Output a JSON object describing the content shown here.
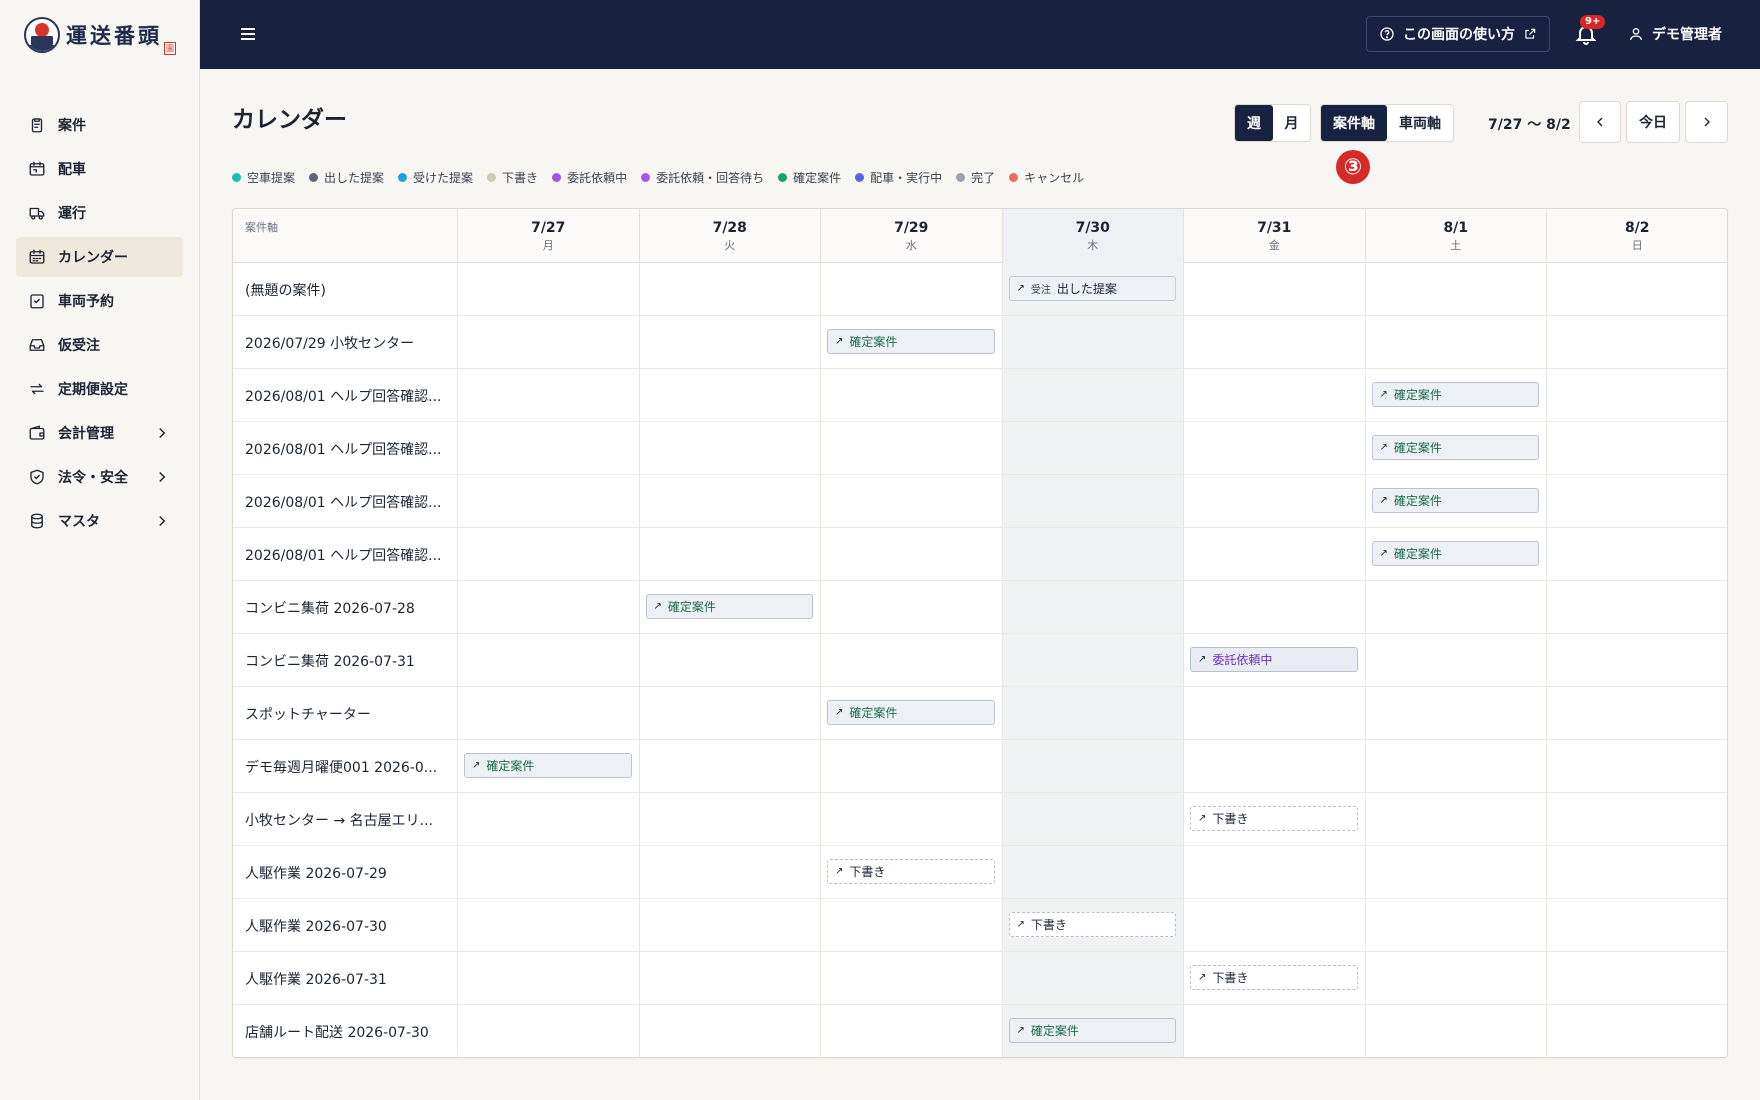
{
  "brand": {
    "name": "運送番頭",
    "seal": "圖"
  },
  "sidebar": {
    "items": [
      {
        "label": "案件",
        "icon": "clipboard-icon"
      },
      {
        "label": "配車",
        "icon": "calendar-truck-icon"
      },
      {
        "label": "運行",
        "icon": "truck-icon"
      },
      {
        "label": "カレンダー",
        "icon": "calendar-icon",
        "active": true
      },
      {
        "label": "車両予約",
        "icon": "calendar-check-icon"
      },
      {
        "label": "仮受注",
        "icon": "inbox-icon"
      },
      {
        "label": "定期便設定",
        "icon": "repeat-icon"
      },
      {
        "label": "会計管理",
        "icon": "wallet-icon",
        "chevron": true
      },
      {
        "label": "法令・安全",
        "icon": "shield-icon",
        "chevron": true
      },
      {
        "label": "マスタ",
        "icon": "database-icon",
        "chevron": true
      }
    ]
  },
  "header": {
    "help_label": "この画面の使い方",
    "badge": "9+",
    "user_label": "デモ管理者"
  },
  "page": {
    "title": "カレンダー",
    "view_week": "週",
    "view_month": "月",
    "axis_case": "案件軸",
    "axis_vehicle": "車両軸",
    "range": "7/27 〜 8/2",
    "today_label": "今日",
    "step_marker": "③"
  },
  "legend": [
    {
      "label": "空車提案",
      "color": "#1bbfb0"
    },
    {
      "label": "出した提案",
      "color": "#5d6678"
    },
    {
      "label": "受けた提案",
      "color": "#1e9fe0"
    },
    {
      "label": "下書き",
      "color": "#d2c8b6"
    },
    {
      "label": "委託依頼中",
      "color": "#9b59e3"
    },
    {
      "label": "委託依頼・回答待ち",
      "color": "#a855f0"
    },
    {
      "label": "確定案件",
      "color": "#14a56a"
    },
    {
      "label": "配車・実行中",
      "color": "#5b62e8"
    },
    {
      "label": "完了",
      "color": "#9aa3b2"
    },
    {
      "label": "キャンセル",
      "color": "#ef6b5f"
    }
  ],
  "grid": {
    "axis_label": "案件軸",
    "days": [
      {
        "date": "7/27",
        "weekday": "月"
      },
      {
        "date": "7/28",
        "weekday": "火"
      },
      {
        "date": "7/29",
        "weekday": "水"
      },
      {
        "date": "7/30",
        "weekday": "木",
        "today": true
      },
      {
        "date": "7/31",
        "weekday": "金"
      },
      {
        "date": "8/1",
        "weekday": "土"
      },
      {
        "date": "8/2",
        "weekday": "日"
      }
    ],
    "rows": [
      {
        "label": "(無題の案件)",
        "day": 3,
        "kind": "dashita",
        "text": "出した提案",
        "tag": "受注"
      },
      {
        "label": "2026/07/29 小牧センター",
        "day": 2,
        "kind": "kakutei",
        "text": "確定案件"
      },
      {
        "label": "2026/08/01 ヘルプ回答確認...",
        "day": 5,
        "kind": "kakutei",
        "text": "確定案件"
      },
      {
        "label": "2026/08/01 ヘルプ回答確認...",
        "day": 5,
        "kind": "kakutei",
        "text": "確定案件"
      },
      {
        "label": "2026/08/01 ヘルプ回答確認...",
        "day": 5,
        "kind": "kakutei",
        "text": "確定案件"
      },
      {
        "label": "2026/08/01 ヘルプ回答確認...",
        "day": 5,
        "kind": "kakutei",
        "text": "確定案件"
      },
      {
        "label": "コンビニ集荷 2026-07-28",
        "day": 1,
        "kind": "kakutei",
        "text": "確定案件"
      },
      {
        "label": "コンビニ集荷 2026-07-31",
        "day": 4,
        "kind": "itaku",
        "text": "委託依頼中"
      },
      {
        "label": "スポットチャーター",
        "day": 2,
        "kind": "kakutei",
        "text": "確定案件"
      },
      {
        "label": "デモ毎週月曜便001 2026-0...",
        "day": 0,
        "kind": "kakutei",
        "text": "確定案件"
      },
      {
        "label": "小牧センター → 名古屋エリ...",
        "day": 4,
        "kind": "draft",
        "text": "下書き"
      },
      {
        "label": "人駆作業 2026-07-29",
        "day": 2,
        "kind": "draft",
        "text": "下書き"
      },
      {
        "label": "人駆作業 2026-07-30",
        "day": 3,
        "kind": "draft",
        "text": "下書き"
      },
      {
        "label": "人駆作業 2026-07-31",
        "day": 4,
        "kind": "draft",
        "text": "下書き"
      },
      {
        "label": "店舗ルート配送 2026-07-30",
        "day": 3,
        "kind": "kakutei",
        "text": "確定案件"
      }
    ]
  }
}
